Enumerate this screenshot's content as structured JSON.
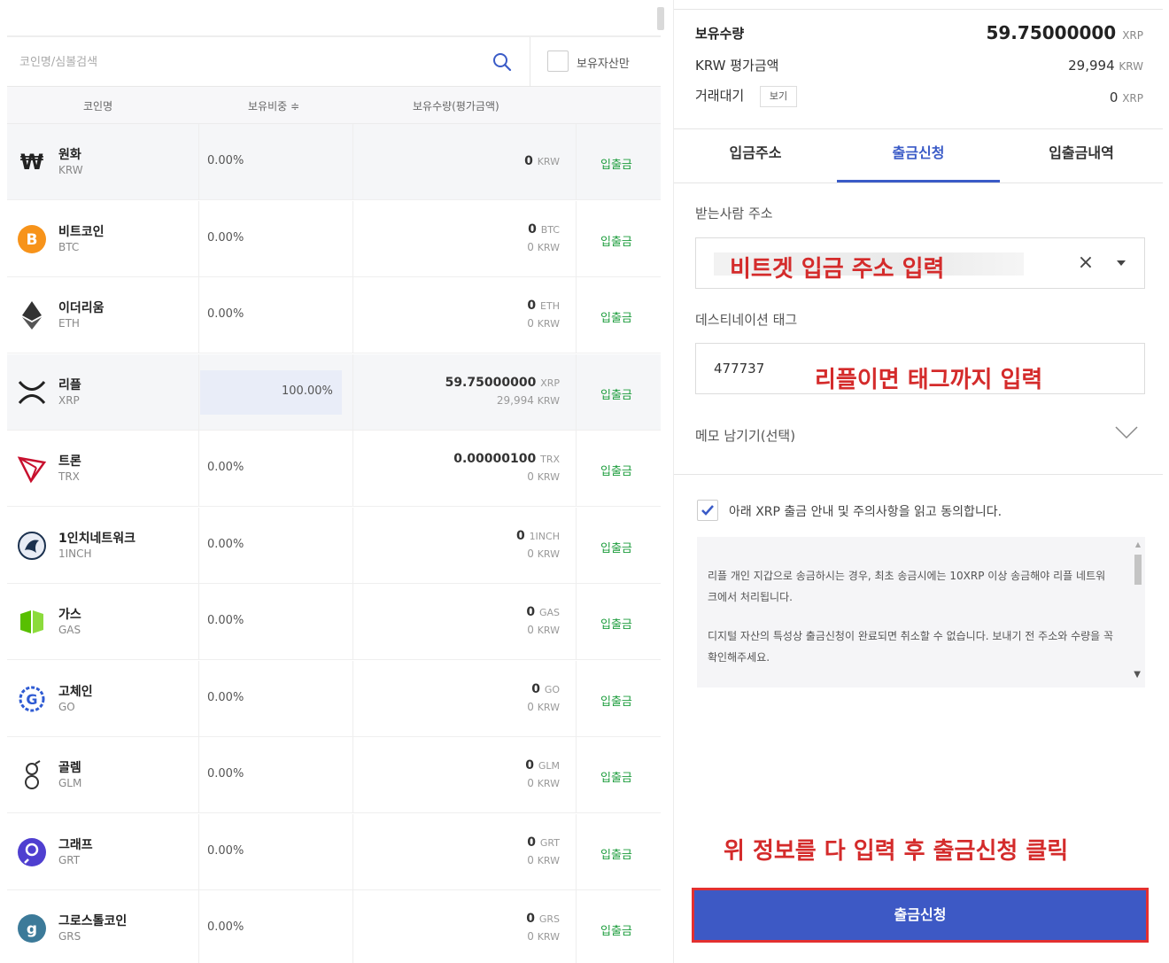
{
  "search": {
    "placeholder": "코인명/심볼검색",
    "owned_only_label": "보유자산만"
  },
  "table": {
    "headers": {
      "name": "코인명",
      "ratio": "보유비중 ≑",
      "holdings": "보유수량(평가금액)"
    },
    "action_label": "입출금",
    "rows": [
      {
        "name": "원화",
        "symbol": "KRW",
        "ratio": "0.00%",
        "amount": "0",
        "amount_unit": "KRW",
        "krw": "",
        "krw_unit": "",
        "icon": "won-icon",
        "color": "#222222"
      },
      {
        "name": "비트코인",
        "symbol": "BTC",
        "ratio": "0.00%",
        "amount": "0",
        "amount_unit": "BTC",
        "krw": "0",
        "krw_unit": "KRW",
        "icon": "bitcoin-icon",
        "color": "#f7931a"
      },
      {
        "name": "이더리움",
        "symbol": "ETH",
        "ratio": "0.00%",
        "amount": "0",
        "amount_unit": "ETH",
        "krw": "0",
        "krw_unit": "KRW",
        "icon": "ethereum-icon",
        "color": "#333333"
      },
      {
        "name": "리플",
        "symbol": "XRP",
        "ratio": "100.00%",
        "amount": "59.75000000",
        "amount_unit": "XRP",
        "krw": "29,994",
        "krw_unit": "KRW",
        "icon": "ripple-icon",
        "color": "#222222"
      },
      {
        "name": "트론",
        "symbol": "TRX",
        "ratio": "0.00%",
        "amount": "0.00000100",
        "amount_unit": "TRX",
        "krw": "0",
        "krw_unit": "KRW",
        "icon": "tron-icon",
        "color": "#c8102e"
      },
      {
        "name": "1인치네트워크",
        "symbol": "1INCH",
        "ratio": "0.00%",
        "amount": "0",
        "amount_unit": "1INCH",
        "krw": "0",
        "krw_unit": "KRW",
        "icon": "1inch-icon",
        "color": "#1b314f"
      },
      {
        "name": "가스",
        "symbol": "GAS",
        "ratio": "0.00%",
        "amount": "0",
        "amount_unit": "GAS",
        "krw": "0",
        "krw_unit": "KRW",
        "icon": "gas-icon",
        "color": "#58bf00"
      },
      {
        "name": "고체인",
        "symbol": "GO",
        "ratio": "0.00%",
        "amount": "0",
        "amount_unit": "GO",
        "krw": "0",
        "krw_unit": "KRW",
        "icon": "gochain-icon",
        "color": "#2f5bd3"
      },
      {
        "name": "골렘",
        "symbol": "GLM",
        "ratio": "0.00%",
        "amount": "0",
        "amount_unit": "GLM",
        "krw": "0",
        "krw_unit": "KRW",
        "icon": "golem-icon",
        "color": "#333333"
      },
      {
        "name": "그래프",
        "symbol": "GRT",
        "ratio": "0.00%",
        "amount": "0",
        "amount_unit": "GRT",
        "krw": "0",
        "krw_unit": "KRW",
        "icon": "graph-icon",
        "color": "#4f3fd0"
      },
      {
        "name": "그로스톨코인",
        "symbol": "GRS",
        "ratio": "0.00%",
        "amount": "0",
        "amount_unit": "GRS",
        "krw": "0",
        "krw_unit": "KRW",
        "icon": "groestlcoin-icon",
        "color": "#3c7a99"
      }
    ]
  },
  "summary": {
    "holdings_label": "보유수량",
    "holdings_value": "59.75000000",
    "holdings_unit": "XRP",
    "krw_label": "KRW 평가금액",
    "krw_value": "29,994",
    "krw_unit": "KRW",
    "pending_label": "거래대기",
    "pending_view": "보기",
    "pending_value": "0",
    "pending_unit": "XRP"
  },
  "tabs": [
    "입금주소",
    "출금신청",
    "입출금내역"
  ],
  "form": {
    "address_label": "받는사람 주소",
    "address_annotation": "비트겟 입금 주소 입력",
    "tag_label": "데스티네이션 태그",
    "tag_value": "477737",
    "tag_annotation": "리플이면 태그까지 입력",
    "memo_label": "메모 남기기(선택)",
    "agree_text": "아래 XRP 출금 안내 및 주의사항을 읽고 동의합니다.",
    "notice_1": "리플 개인 지갑으로 송금하시는 경우, 최초 송금시에는 10XRP 이상 송금해야 리플 네트워크에서 처리됩니다.",
    "notice_2": "디지털 자산의 특성상 출금신청이 완료되면 취소할 수 없습니다. 보내기 전 주소와 수량을 꼭 확인해주세요.",
    "bottom_annotation": "위 정보를 다 입력 후 출금신청 클릭",
    "submit_label": "출금신청"
  },
  "colors": {
    "accent": "#3d59c5",
    "link": "#1e9d3e",
    "annotation": "#d42b2b"
  }
}
